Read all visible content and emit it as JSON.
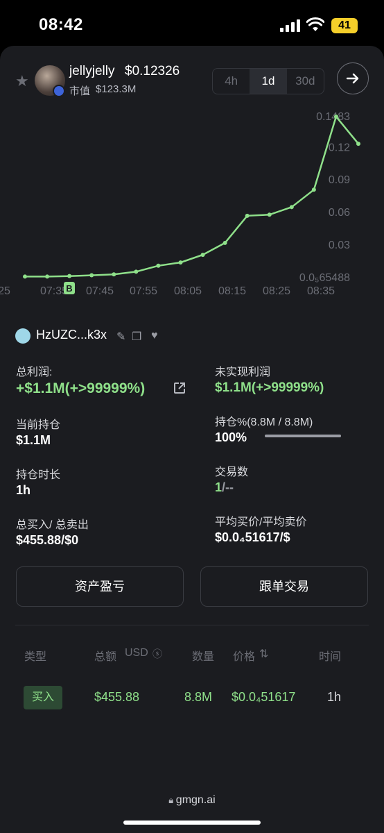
{
  "status_bar": {
    "time": "08:42",
    "battery": "41"
  },
  "token": {
    "name": "jellyjelly",
    "price": "$0.12326",
    "mcap_label": "市值",
    "mcap_value": "$123.3M"
  },
  "timeframes": [
    {
      "label": "4h",
      "active": false
    },
    {
      "label": "1d",
      "active": true
    },
    {
      "label": "30d",
      "active": false
    }
  ],
  "chart_data": {
    "type": "line",
    "x": [
      "07:35",
      "07:40",
      "07:45",
      "07:50",
      "07:55",
      "08:00",
      "08:05",
      "08:10",
      "08:15",
      "08:20",
      "08:25",
      "08:30",
      "08:35",
      "08:40",
      "08:42"
    ],
    "y": [
      0.001,
      0.001,
      0.0015,
      0.0022,
      0.003,
      0.0055,
      0.011,
      0.014,
      0.021,
      0.032,
      0.057,
      0.058,
      0.065,
      0.081,
      0.1483,
      0.1233
    ],
    "x_ticks": [
      "25",
      "07:35",
      "07:45",
      "07:55",
      "08:05",
      "08:15",
      "08:25",
      "08:35"
    ],
    "y_ticks": [
      "0.1483",
      "0.12",
      "0.09",
      "0.06",
      "0.03",
      "0.0₅65488"
    ],
    "ylim": [
      6.5488e-06,
      0.1483
    ],
    "color": "#8fe08a",
    "marker": "B"
  },
  "trader": {
    "address": "HzUZC...k3x"
  },
  "stats": {
    "total_profit_label": "总利润:",
    "total_profit_value": "+$1.1M(+>99999%)",
    "unrealized_label": "未实现利润",
    "unrealized_value": "$1.1M(+>99999%)",
    "position_label": "当前持仓",
    "position_value": "$1.1M",
    "holding_pct_label": "持仓%(8.8M / 8.8M)",
    "holding_pct_value": "100%",
    "holding_pct": 1.0,
    "duration_label": "持仓时长",
    "duration_value": "1h",
    "trades_label": "交易数",
    "trades_value_buy": "1",
    "trades_value_sell": "/--",
    "buy_sell_label": "总买入/ 总卖出",
    "buy_sell_value": "$455.88/$0",
    "avg_price_label": "平均买价/平均卖价",
    "avg_price_value": "$0.0₄51617/$"
  },
  "buttons": {
    "pnl": "资产盈亏",
    "copy_trade": "跟单交易"
  },
  "table": {
    "headers": {
      "type": "类型",
      "total": "总额",
      "usd": "USD",
      "qty": "数量",
      "price": "价格",
      "time": "时间"
    },
    "rows": [
      {
        "type": "买入",
        "total": "$455.88",
        "qty": "8.8M",
        "price": "$0.0₄51617",
        "time": "1h"
      }
    ]
  },
  "browser": {
    "url": "gmgn.ai"
  }
}
